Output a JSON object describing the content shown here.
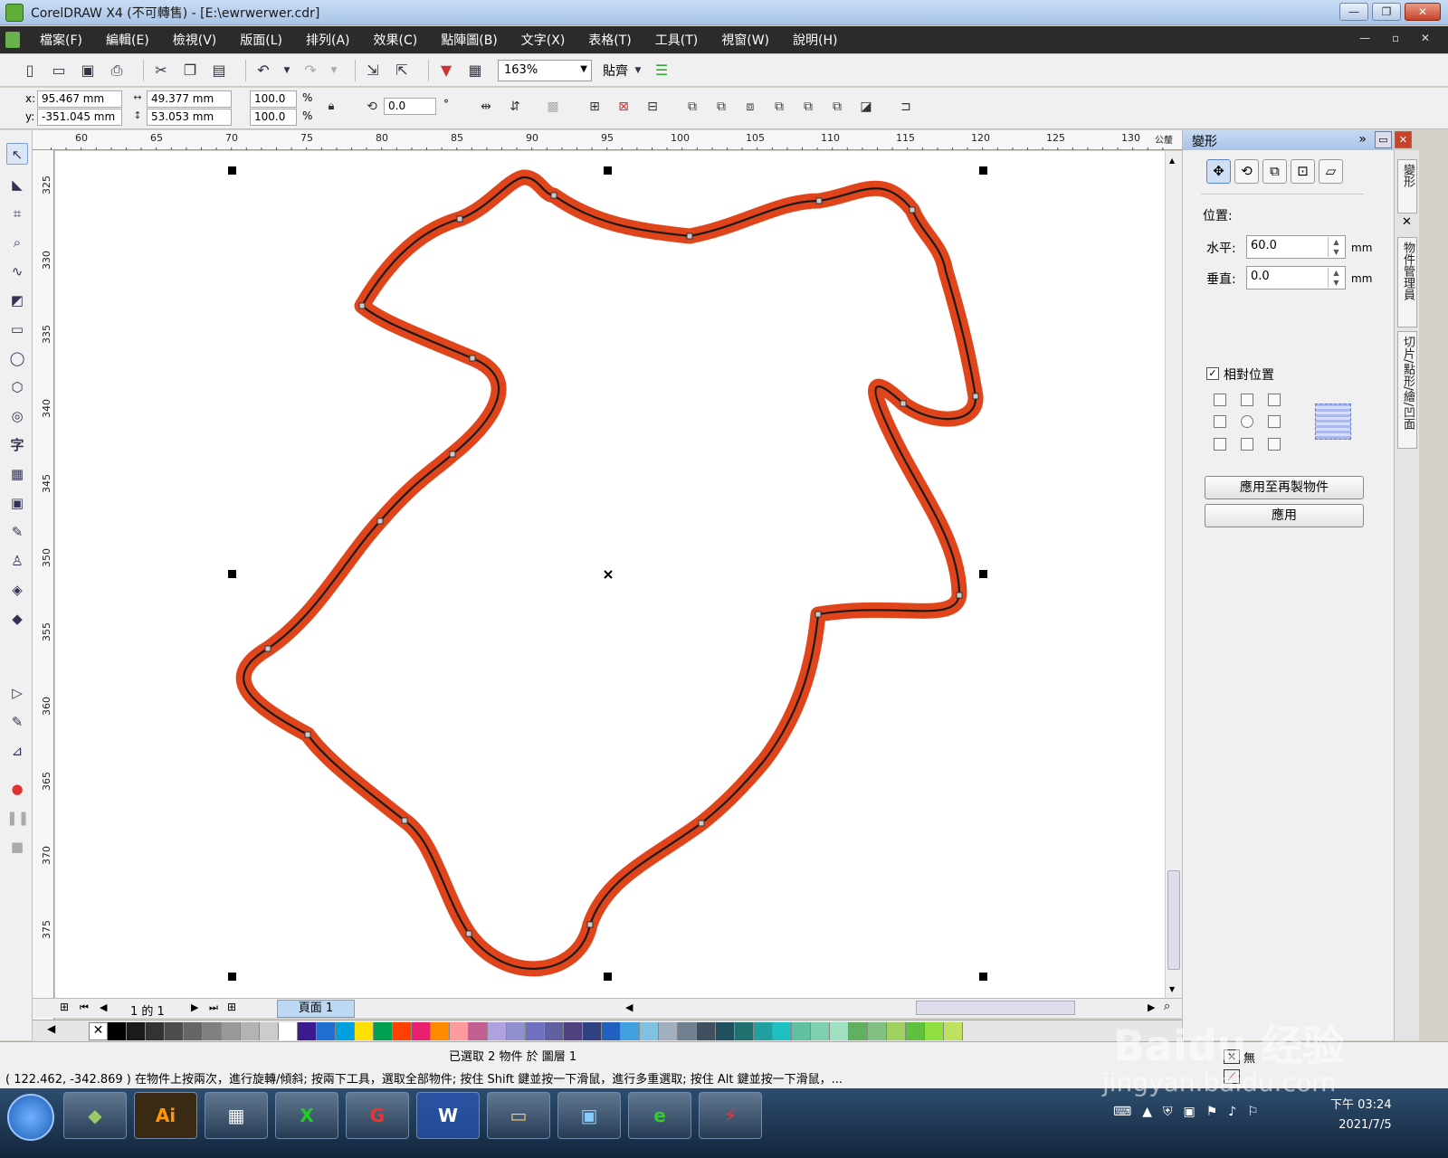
{
  "window": {
    "title": "CorelDRAW X4 (不可轉售) - [E:\\ewrwerwer.cdr]",
    "min": "—",
    "max": "❐",
    "close": "✕"
  },
  "menu": {
    "items": [
      "檔案(F)",
      "編輯(E)",
      "檢視(V)",
      "版面(L)",
      "排列(A)",
      "效果(C)",
      "點陣圖(B)",
      "文字(X)",
      "表格(T)",
      "工具(T)",
      "視窗(W)",
      "說明(H)"
    ],
    "doc_controls": "— ▫ ✕"
  },
  "toolbar": {
    "zoom": "163%",
    "snap": "貼齊",
    "icons": [
      "new-icon",
      "open-icon",
      "save-icon",
      "print-icon",
      "cut-icon",
      "copy-icon",
      "paste-icon",
      "undo-icon",
      "redo-icon",
      "import-icon",
      "export-icon",
      "publish-icon",
      "app-launcher-icon",
      "welcome-icon"
    ]
  },
  "property_bar": {
    "x_label": "x:",
    "x": "95.467 mm",
    "y_label": "y:",
    "y": "-351.045 mm",
    "w": "49.377 mm",
    "h": "53.053 mm",
    "scale_w": "100.0",
    "scale_h": "100.0",
    "pct": "%",
    "rotation": "0.0",
    "deg": "°"
  },
  "ruler": {
    "h_ticks": [
      "60",
      "65",
      "70",
      "75",
      "80",
      "85",
      "90",
      "95",
      "100",
      "105",
      "110",
      "115",
      "120",
      "125",
      "130",
      "公釐"
    ],
    "v_ticks": [
      "325",
      "330",
      "335",
      "340",
      "345",
      "350",
      "355",
      "360",
      "365",
      "370",
      "375"
    ]
  },
  "page_nav": {
    "position": "1 的 1",
    "tab": "頁面 1"
  },
  "palette": {
    "colors": [
      "#000000",
      "#1a1a1a",
      "#333333",
      "#4d4d4d",
      "#666666",
      "#808080",
      "#999999",
      "#b3b3b3",
      "#cccccc",
      "#ffffff",
      "#3a1a8c",
      "#1f6fd1",
      "#00a0e0",
      "#ffe000",
      "#00a050",
      "#ff4000",
      "#e8206e",
      "#ff8c00",
      "#ff9aa0",
      "#c06090",
      "#b0a0e0",
      "#9090d0",
      "#7070c0",
      "#6060a0",
      "#504080",
      "#304080",
      "#2060c0",
      "#40a0e0",
      "#80c0e0",
      "#a0b0c0",
      "#708090",
      "#405060",
      "#205060",
      "#207070",
      "#20a0a0",
      "#20c0c0",
      "#60c0a0",
      "#80d0b0",
      "#a0e0c0",
      "#60b060",
      "#80c080",
      "#a0d060",
      "#60c040",
      "#90e040",
      "#c0e060"
    ]
  },
  "docker": {
    "title": "變形",
    "expand": "»",
    "position_label": "位置:",
    "h_label": "水平:",
    "h_value": "60.0",
    "v_label": "垂直:",
    "v_value": "0.0",
    "unit": "mm",
    "relative_label": "相對位置",
    "relative_checked": "✓",
    "apply_dup": "應用至再製物件",
    "apply": "應用"
  },
  "side_tabs": [
    "變形",
    "物件管理員",
    "切片/點形/繪/凹面"
  ],
  "status": {
    "selection": "已選取 2 物件 於 圖層 1",
    "hint": "( 122.462, -342.869 )  在物件上按兩次，進行旋轉/傾斜; 按兩下工具，選取全部物件; 按住 Shift 鍵並按一下滑鼠，進行多重選取; 按住 Alt 鍵並按一下滑鼠，...",
    "fill_none": "無"
  },
  "taskbar": {
    "apps": [
      "corel-icon",
      "Ai",
      "calculator-icon",
      "excel-icon",
      "app-icon",
      "W",
      "explorer-icon",
      "network-icon",
      "ie-icon",
      "pdf-icon"
    ],
    "time": "下午 03:24",
    "date": "2021/7/5"
  },
  "watermark": {
    "brand": "Baidu 经验",
    "url": "jingyan.baidu.com"
  },
  "colors": {
    "outline_orange": "#e0441a",
    "inner_line": "#1a1a1a",
    "menu_bg": "#2b2b2b"
  }
}
